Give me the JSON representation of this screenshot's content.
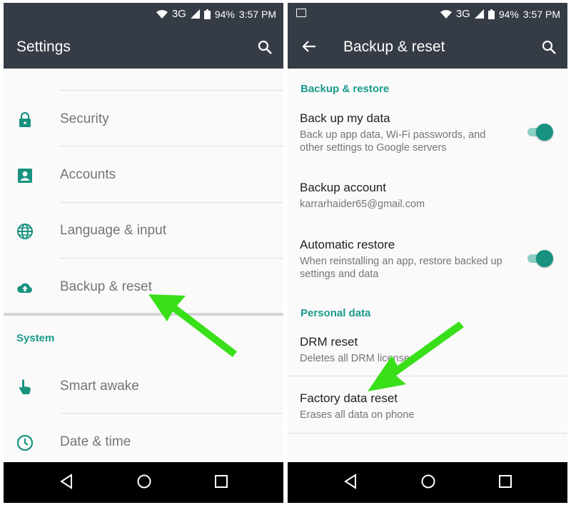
{
  "status": {
    "network": "3G",
    "battery": "94%",
    "time": "3:57 PM"
  },
  "left": {
    "title": "Settings",
    "items": [
      {
        "label": "Security",
        "icon": "lock-icon"
      },
      {
        "label": "Accounts",
        "icon": "account-box-icon"
      },
      {
        "label": "Language & input",
        "icon": "globe-icon"
      },
      {
        "label": "Backup & reset",
        "icon": "cloud-upload-icon"
      }
    ],
    "section": "System",
    "system_items": [
      {
        "label": "Smart awake",
        "icon": "touch-hand-icon"
      },
      {
        "label": "Date & time",
        "icon": "clock-icon"
      }
    ]
  },
  "right": {
    "title": "Backup & reset",
    "section1": "Backup & restore",
    "items": [
      {
        "title": "Back up my data",
        "sub": "Back up app data, Wi-Fi passwords, and other settings to Google servers",
        "toggle": true
      },
      {
        "title": "Backup account",
        "sub": "karrarhaider65@gmail.com"
      },
      {
        "title": "Automatic restore",
        "sub": "When reinstalling an app, restore backed up settings and data",
        "toggle": true
      }
    ],
    "section2": "Personal data",
    "personal": [
      {
        "title": "DRM reset",
        "sub": "Deletes all DRM licenses"
      },
      {
        "title": "Factory data reset",
        "sub": "Erases all data on phone"
      }
    ]
  },
  "colors": {
    "toolbar": "#363c45",
    "accent": "#1a9a8a",
    "arrow": "#39e01a"
  }
}
